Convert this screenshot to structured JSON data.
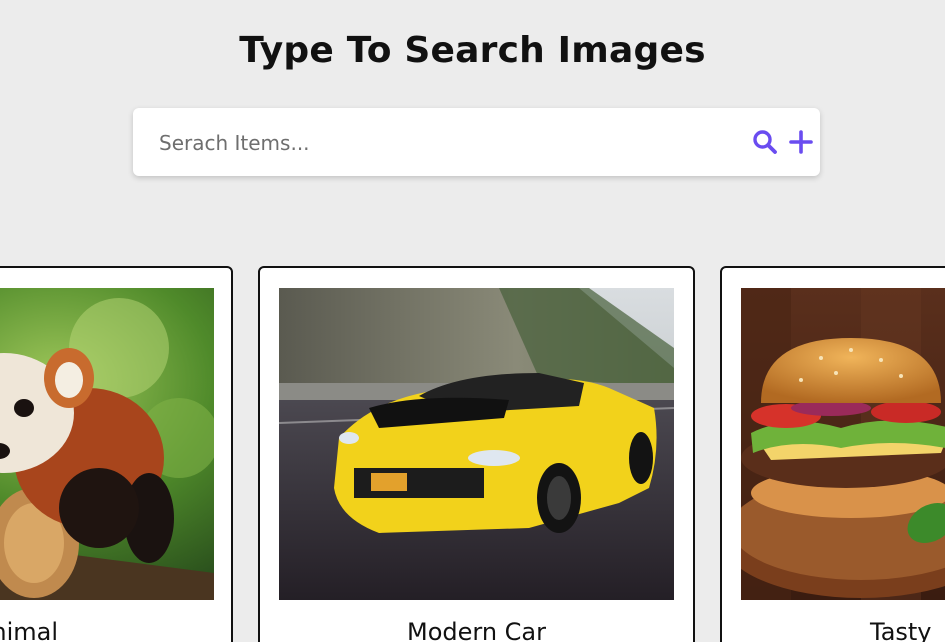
{
  "header": {
    "title": "Type To Search Images"
  },
  "search": {
    "placeholder": "Serach Items...",
    "value": "",
    "search_icon": "search-icon",
    "add_icon": "plus-icon"
  },
  "colors": {
    "accent": "#6a4cf0",
    "background": "#ececec"
  },
  "cards": [
    {
      "title": "Animal",
      "image": "red panda on a tree branch"
    },
    {
      "title": "Modern Car",
      "image": "yellow sports car on a road"
    },
    {
      "title": "Tasty",
      "image": "burger on a wooden board"
    }
  ]
}
